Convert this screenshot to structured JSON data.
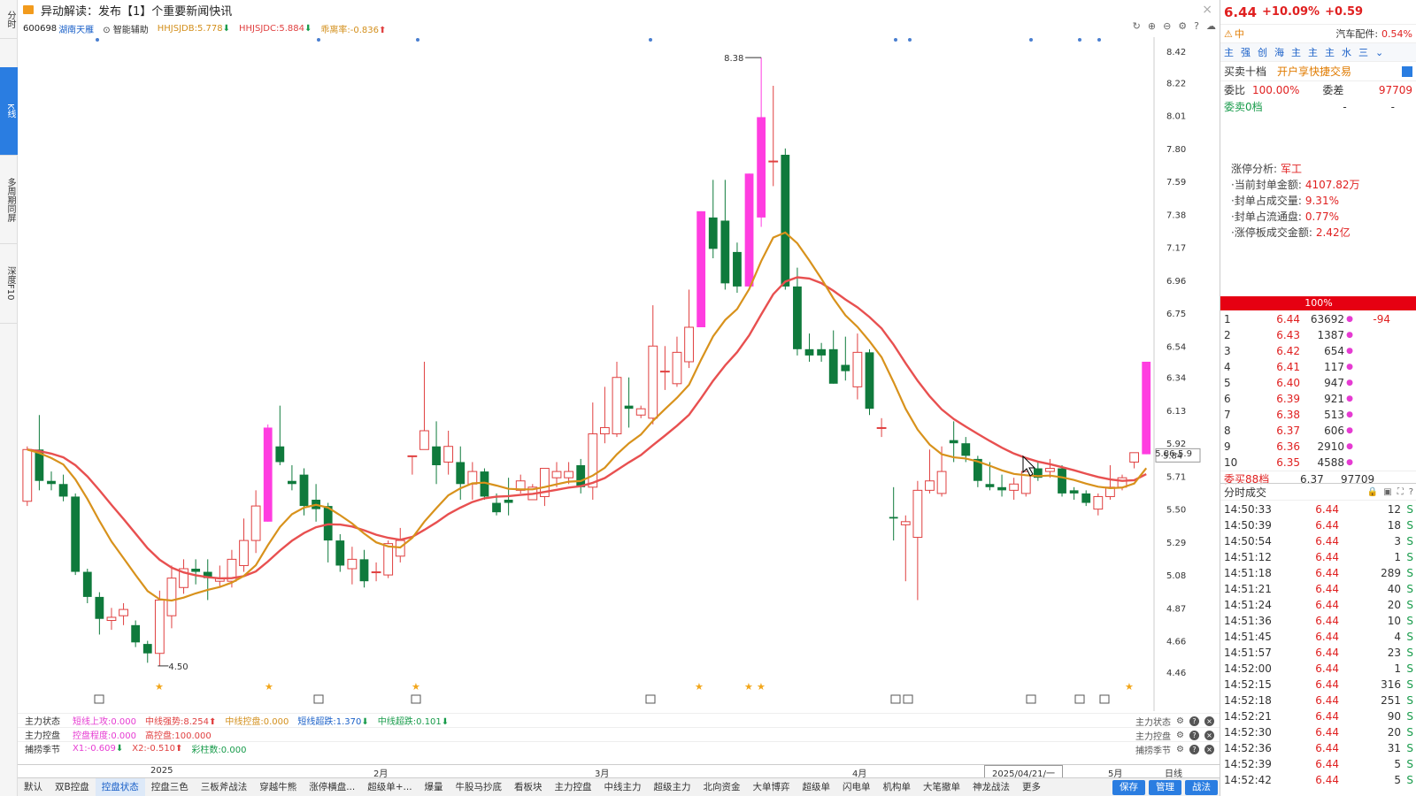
{
  "left_tabs": [
    "分时",
    "K线",
    "多周期同屏",
    "深度F10"
  ],
  "news": {
    "text": "异动解读：发布【1】个重要新闻快讯",
    "close": "×"
  },
  "info": {
    "code": "600698",
    "name": "湖南天雁",
    "assist": "智能辅助",
    "ind1": "HHJSJDB:5.778",
    "ind2": "HHJSJDC:5.884",
    "ind3": "乖离率:-0.836"
  },
  "price_axis": [
    "8.42",
    "8.22",
    "8.01",
    "7.80",
    "7.59",
    "7.38",
    "7.17",
    "6.96",
    "6.75",
    "6.54",
    "6.34",
    "6.13",
    "5.92",
    "5.71",
    "5.50",
    "5.29",
    "5.08",
    "4.87",
    "4.66",
    "4.46"
  ],
  "price_axis_current": "5.84",
  "annotations": {
    "high": "8.38",
    "low": "4.50",
    "last": "5.86-5.9"
  },
  "ind_rows": [
    {
      "label": "主力状态",
      "items": [
        {
          "text": "短线上攻:0.000",
          "color": "#e63bd2"
        },
        {
          "text": "中线强势:8.254",
          "color": "#e04040"
        },
        {
          "text": "中线控盘:0.000",
          "color": "#d38f1b"
        },
        {
          "text": "短线超跌:1.370",
          "color": "#1a60c8"
        },
        {
          "text": "中线超跌:0.101",
          "color": "#179b4a"
        }
      ]
    },
    {
      "label": "主力控盘",
      "items": [
        {
          "text": "控盘程度:0.000",
          "color": "#e63bd2"
        },
        {
          "text": "高控盘:100.000",
          "color": "#e04040"
        }
      ]
    },
    {
      "label": "捕捞季节",
      "items": [
        {
          "text": "X1:-0.609",
          "color": "#e63bd2"
        },
        {
          "text": "X2:-0.510",
          "color": "#e04040"
        },
        {
          "text": "彩柱数:0.000",
          "color": "#179b4a"
        }
      ]
    }
  ],
  "ind_row_right": [
    "主力状态",
    "主力控盘",
    "捕捞季节"
  ],
  "months": [
    "2025",
    "2月",
    "3月",
    "4月",
    "2025/04/21/一",
    "5月",
    "日线"
  ],
  "bottom_tabs": [
    "默认",
    "双B控盘",
    "控盘状态",
    "控盘三色",
    "三板斧战法",
    "穿越牛熊",
    "涨停横盘...",
    "超级单+...",
    "爆量",
    "牛股马抄底",
    "看板块",
    "主力控盘",
    "中线主力",
    "超级主力",
    "北向资金",
    "大单博弈",
    "超级单",
    "闪电单",
    "机构单",
    "大笔撤单",
    "神龙战法",
    "更多"
  ],
  "bottom_buttons": [
    "保存",
    "管理",
    "战法"
  ],
  "quote": {
    "price": "6.44",
    "pct": "+10.09%",
    "chg": "+0.59"
  },
  "sector": {
    "tag": "中",
    "name": "汽车配件:",
    "pct": "0.54%"
  },
  "quick_icons": [
    "主",
    "强",
    "创",
    "海",
    "主",
    "主",
    "主",
    "水",
    "三"
  ],
  "trade": {
    "title": "买卖十档",
    "promo": "开户享快捷交易"
  },
  "ratio": {
    "k1": "委比",
    "v1": "100.00%",
    "k2": "委差",
    "v2": "97709"
  },
  "ask_zero": {
    "label": "委卖0档",
    "d1": "-",
    "d2": "-"
  },
  "limit_analysis": {
    "title": "涨停分析:",
    "title_val": "军工",
    "rows": [
      {
        "k": "·当前封单金额:",
        "v": "4107.82万"
      },
      {
        "k": "·封单占成交量:",
        "v": "9.31%"
      },
      {
        "k": "·封单占流通盘:",
        "v": "0.77%"
      },
      {
        "k": "·涨停板成交金额:",
        "v": "2.42亿"
      }
    ]
  },
  "fill_bar": "100%",
  "bids": [
    {
      "lv": "1",
      "px": "6.44",
      "vol": "63692",
      "chg": "-94"
    },
    {
      "lv": "2",
      "px": "6.43",
      "vol": "1387",
      "chg": ""
    },
    {
      "lv": "3",
      "px": "6.42",
      "vol": "654",
      "chg": ""
    },
    {
      "lv": "4",
      "px": "6.41",
      "vol": "117",
      "chg": ""
    },
    {
      "lv": "5",
      "px": "6.40",
      "vol": "947",
      "chg": ""
    },
    {
      "lv": "6",
      "px": "6.39",
      "vol": "921",
      "chg": ""
    },
    {
      "lv": "7",
      "px": "6.38",
      "vol": "513",
      "chg": ""
    },
    {
      "lv": "8",
      "px": "6.37",
      "vol": "606",
      "chg": ""
    },
    {
      "lv": "9",
      "px": "6.36",
      "vol": "2910",
      "chg": ""
    },
    {
      "lv": "10",
      "px": "6.35",
      "vol": "4588",
      "chg": ""
    }
  ],
  "buy_summary": {
    "label": "委买88档",
    "px": "6.37",
    "vol": "97709"
  },
  "tick_title": "分时成交",
  "ticks": [
    {
      "t": "14:50:33",
      "p": "6.44",
      "v": "12",
      "s": "S"
    },
    {
      "t": "14:50:39",
      "p": "6.44",
      "v": "18",
      "s": "S"
    },
    {
      "t": "14:50:54",
      "p": "6.44",
      "v": "3",
      "s": "S"
    },
    {
      "t": "14:51:12",
      "p": "6.44",
      "v": "1",
      "s": "S"
    },
    {
      "t": "14:51:18",
      "p": "6.44",
      "v": "289",
      "s": "S"
    },
    {
      "t": "14:51:21",
      "p": "6.44",
      "v": "40",
      "s": "S"
    },
    {
      "t": "14:51:24",
      "p": "6.44",
      "v": "20",
      "s": "S"
    },
    {
      "t": "14:51:36",
      "p": "6.44",
      "v": "10",
      "s": "S"
    },
    {
      "t": "14:51:45",
      "p": "6.44",
      "v": "4",
      "s": "S"
    },
    {
      "t": "14:51:57",
      "p": "6.44",
      "v": "23",
      "s": "S"
    },
    {
      "t": "14:52:00",
      "p": "6.44",
      "v": "1",
      "s": "S"
    },
    {
      "t": "14:52:15",
      "p": "6.44",
      "v": "316",
      "s": "S"
    },
    {
      "t": "14:52:18",
      "p": "6.44",
      "v": "251",
      "s": "S"
    },
    {
      "t": "14:52:21",
      "p": "6.44",
      "v": "90",
      "s": "S"
    },
    {
      "t": "14:52:30",
      "p": "6.44",
      "v": "20",
      "s": "S"
    },
    {
      "t": "14:52:36",
      "p": "6.44",
      "v": "31",
      "s": "S"
    },
    {
      "t": "14:52:39",
      "p": "6.44",
      "v": "5",
      "s": "S"
    },
    {
      "t": "14:52:42",
      "p": "6.44",
      "v": "5",
      "s": "S"
    }
  ],
  "colors": {
    "up": "#e04040",
    "down": "#0f7a3c",
    "limit_up": "#ff3de0",
    "ma_fast": "#d8921c",
    "ma_slow": "#e85050"
  },
  "chart_data": {
    "type": "candlestick",
    "ylim": [
      4.46,
      8.42
    ],
    "candles": [
      [
        5.55,
        5.88,
        5.9,
        5.52
      ],
      [
        5.88,
        5.68,
        6.1,
        5.62
      ],
      [
        5.68,
        5.66,
        5.74,
        5.62
      ],
      [
        5.66,
        5.58,
        5.72,
        5.55
      ],
      [
        5.58,
        5.1,
        5.6,
        5.08
      ],
      [
        5.1,
        4.94,
        5.12,
        4.9
      ],
      [
        4.94,
        4.8,
        4.97,
        4.7
      ],
      [
        4.79,
        4.81,
        4.87,
        4.73
      ],
      [
        4.82,
        4.86,
        4.9,
        4.76
      ],
      [
        4.76,
        4.65,
        4.79,
        4.62
      ],
      [
        4.64,
        4.58,
        4.66,
        4.52
      ],
      [
        4.58,
        4.92,
        4.98,
        4.5
      ],
      [
        4.82,
        5.06,
        5.14,
        4.74
      ],
      [
        5.0,
        5.12,
        5.18,
        4.96
      ],
      [
        5.12,
        5.1,
        5.18,
        5.02
      ],
      [
        5.1,
        5.06,
        5.18,
        4.92
      ],
      [
        5.04,
        5.06,
        5.14,
        5.0
      ],
      [
        5.04,
        5.18,
        5.24,
        5.0
      ],
      [
        5.14,
        5.3,
        5.44,
        5.1
      ],
      [
        5.3,
        5.52,
        5.62,
        5.22
      ],
      [
        5.42,
        6.02,
        6.04,
        5.42
      ],
      [
        5.9,
        5.8,
        6.16,
        5.78
      ],
      [
        5.68,
        5.66,
        5.78,
        5.62
      ],
      [
        5.72,
        5.52,
        5.76,
        5.46
      ],
      [
        5.56,
        5.5,
        5.66,
        5.42
      ],
      [
        5.52,
        5.3,
        5.54,
        5.16
      ],
      [
        5.3,
        5.14,
        5.34,
        5.1
      ],
      [
        5.12,
        5.18,
        5.26,
        5.02
      ],
      [
        5.18,
        5.04,
        5.24,
        5.0
      ],
      [
        5.1,
        5.1,
        5.16,
        5.04
      ],
      [
        5.08,
        5.28,
        5.3,
        5.06
      ],
      [
        5.2,
        5.3,
        5.38,
        5.16
      ],
      [
        5.84,
        5.84,
        5.84,
        5.72
      ],
      [
        5.88,
        6.0,
        6.44,
        5.88
      ],
      [
        5.9,
        5.78,
        6.06,
        5.66
      ],
      [
        5.8,
        5.9,
        6.0,
        5.72
      ],
      [
        5.8,
        5.66,
        5.9,
        5.56
      ],
      [
        5.66,
        5.74,
        5.8,
        5.56
      ],
      [
        5.74,
        5.58,
        5.76,
        5.56
      ],
      [
        5.54,
        5.48,
        5.6,
        5.46
      ],
      [
        5.56,
        5.54,
        5.7,
        5.46
      ],
      [
        5.62,
        5.68,
        5.72,
        5.6
      ],
      [
        5.56,
        5.64,
        5.66,
        5.56
      ],
      [
        5.58,
        5.76,
        5.76,
        5.52
      ],
      [
        5.7,
        5.74,
        5.8,
        5.64
      ],
      [
        5.7,
        5.74,
        5.8,
        5.66
      ],
      [
        5.78,
        5.64,
        5.82,
        5.6
      ],
      [
        5.64,
        5.98,
        6.18,
        5.56
      ],
      [
        5.98,
        6.02,
        6.28,
        5.92
      ],
      [
        5.98,
        6.34,
        6.44,
        5.96
      ],
      [
        6.16,
        6.14,
        6.34,
        6.02
      ],
      [
        6.1,
        6.14,
        6.16,
        6.08
      ],
      [
        6.08,
        6.54,
        6.8,
        6.04
      ],
      [
        6.38,
        6.38,
        6.54,
        6.26
      ],
      [
        6.3,
        6.5,
        6.6,
        6.28
      ],
      [
        6.44,
        6.66,
        6.9,
        6.4
      ],
      [
        6.66,
        7.4,
        7.4,
        6.66
      ],
      [
        7.36,
        7.16,
        7.6,
        7.1
      ],
      [
        7.34,
        6.94,
        7.6,
        6.9
      ],
      [
        7.14,
        6.92,
        7.2,
        6.88
      ],
      [
        6.92,
        7.64,
        7.64,
        6.92
      ],
      [
        7.36,
        8.0,
        8.38,
        7.3
      ],
      [
        7.72,
        7.72,
        8.2,
        7.56
      ],
      [
        7.76,
        6.92,
        7.8,
        6.9
      ],
      [
        6.92,
        6.52,
        7.04,
        6.48
      ],
      [
        6.52,
        6.48,
        6.62,
        6.44
      ],
      [
        6.52,
        6.48,
        6.56,
        6.44
      ],
      [
        6.52,
        6.3,
        6.64,
        6.3
      ],
      [
        6.42,
        6.38,
        6.6,
        6.32
      ],
      [
        6.28,
        6.5,
        6.62,
        6.2
      ],
      [
        6.5,
        6.14,
        6.52,
        6.1
      ],
      [
        6.02,
        6.02,
        6.08,
        5.96
      ],
      [
        5.45,
        5.44,
        5.64,
        5.3
      ],
      [
        5.4,
        5.42,
        5.46,
        5.04
      ],
      [
        5.32,
        5.62,
        5.68,
        4.92
      ],
      [
        5.62,
        5.68,
        5.88,
        5.6
      ],
      [
        5.6,
        5.74,
        5.9,
        5.58
      ],
      [
        5.94,
        5.92,
        6.06,
        5.8
      ],
      [
        5.92,
        5.84,
        5.96,
        5.8
      ],
      [
        5.82,
        5.68,
        5.84,
        5.64
      ],
      [
        5.66,
        5.64,
        5.8,
        5.62
      ],
      [
        5.64,
        5.62,
        5.72,
        5.58
      ],
      [
        5.62,
        5.66,
        5.7,
        5.56
      ],
      [
        5.6,
        5.74,
        5.74,
        5.58
      ],
      [
        5.76,
        5.7,
        5.8,
        5.68
      ],
      [
        5.74,
        5.76,
        5.82,
        5.7
      ],
      [
        5.76,
        5.6,
        5.78,
        5.58
      ],
      [
        5.62,
        5.6,
        5.64,
        5.56
      ],
      [
        5.6,
        5.54,
        5.62,
        5.52
      ],
      [
        5.5,
        5.58,
        5.6,
        5.46
      ],
      [
        5.58,
        5.64,
        5.78,
        5.56
      ],
      [
        5.64,
        5.7,
        5.72,
        5.62
      ],
      [
        5.8,
        5.86,
        5.86,
        5.76
      ],
      [
        5.85,
        6.44,
        6.44,
        5.85
      ]
    ]
  }
}
